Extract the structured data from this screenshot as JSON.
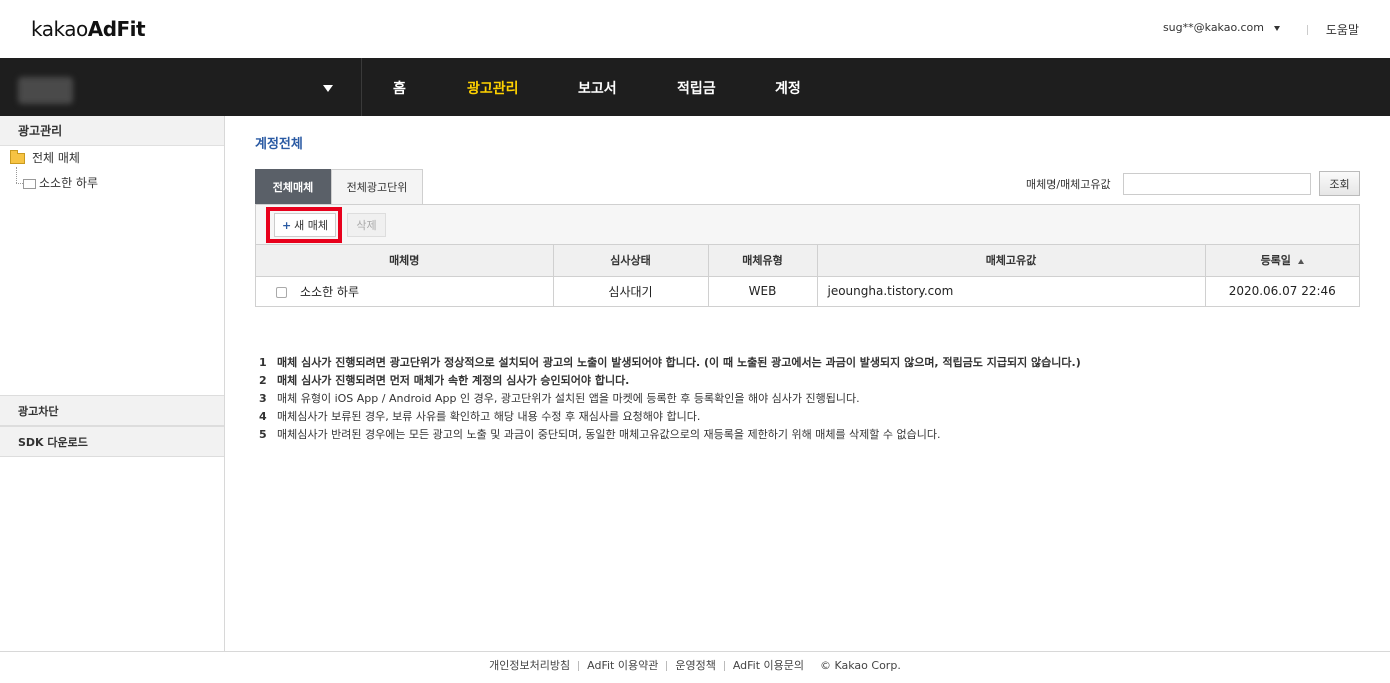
{
  "header": {
    "logo_light": "kakao",
    "logo_bold": "AdFit",
    "account": "sug**@kakao.com",
    "help": "도움말"
  },
  "nav": {
    "items": [
      {
        "label": "홈"
      },
      {
        "label": "광고관리"
      },
      {
        "label": "보고서"
      },
      {
        "label": "적립금"
      },
      {
        "label": "계정"
      }
    ],
    "active": "광고관리",
    "active_color": "#ffd200"
  },
  "sidebar": {
    "title": "광고관리",
    "tree_root": "전체 매체",
    "tree_child": "소소한 하루",
    "block1": "광고차단",
    "block2": "SDK 다운로드"
  },
  "main": {
    "title": "계정전체",
    "tabs": [
      "전체매체",
      "전체광고단위"
    ],
    "search_label": "매체명/매체고유값",
    "search_value": "",
    "search_button": "조회",
    "new_button": "새 매체",
    "delete_button": "삭제",
    "columns": [
      "매체명",
      "심사상태",
      "매체유형",
      "매체고유값",
      "등록일"
    ],
    "rows": [
      {
        "name": "소소한 하루",
        "status": "심사대기",
        "type": "WEB",
        "key": "jeoungha.tistory.com",
        "date": "2020.06.07 22:46"
      }
    ],
    "notes": [
      {
        "num": "1",
        "text": "매체 심사가 진행되려면 광고단위가 정상적으로 설치되어 광고의 노출이 발생되어야 합니다. (이 때 노출된 광고에서는 과금이 발생되지 않으며, 적립금도 지급되지 않습니다.)"
      },
      {
        "num": "2",
        "text": "매체 심사가 진행되려면 먼저 매체가 속한 계정의 심사가 승인되어야 합니다."
      },
      {
        "num": "3",
        "text": "매체 유형이 iOS App / Android App 인 경우, 광고단위가 설치된 앱을 마켓에 등록한 후 등록확인을 해야 심사가 진행됩니다."
      },
      {
        "num": "4",
        "text": "매체심사가 보류된 경우, 보류 사유를 확인하고 해당 내용 수정 후 재심사를 요청해야 합니다."
      },
      {
        "num": "5",
        "text": "매체심사가 반려된 경우에는 모든 광고의 노출 및 과금이 중단되며, 동일한 매체고유값으로의 재등록을 제한하기 위해 매체를 삭제할 수 없습니다."
      }
    ]
  },
  "footer": {
    "links": [
      "개인정보처리방침",
      "AdFit 이용약관",
      "운영정책",
      "AdFit 이용문의"
    ],
    "copyright": "© Kakao Corp."
  }
}
